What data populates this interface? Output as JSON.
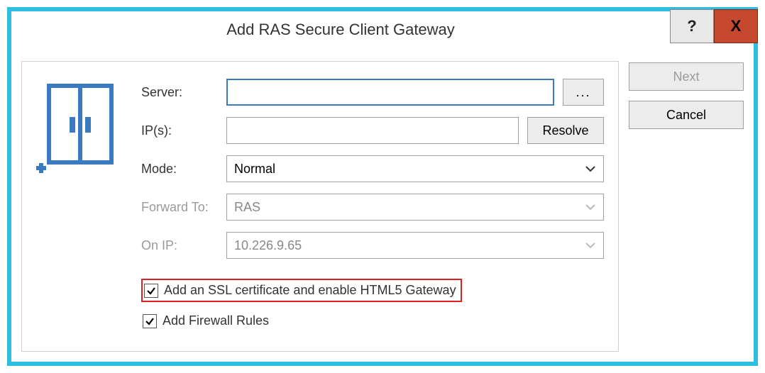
{
  "dialog": {
    "title": "Add RAS Secure Client Gateway"
  },
  "titlebar": {
    "help_label": "?",
    "close_label": "X"
  },
  "form": {
    "server_label": "Server:",
    "server_value": "",
    "ips_label": "IP(s):",
    "ips_value": "",
    "resolve_label": "Resolve",
    "browse_label": "...",
    "mode_label": "Mode:",
    "mode_value": "Normal",
    "forward_label": "Forward To:",
    "forward_value": "RAS",
    "onip_label": "On IP:",
    "onip_value": "10.226.9.65",
    "ssl_checkbox_label": "Add an SSL certificate and enable HTML5 Gateway",
    "ssl_checked": true,
    "firewall_checkbox_label": "Add Firewall Rules",
    "firewall_checked": true
  },
  "buttons": {
    "next_label": "Next",
    "cancel_label": "Cancel"
  }
}
